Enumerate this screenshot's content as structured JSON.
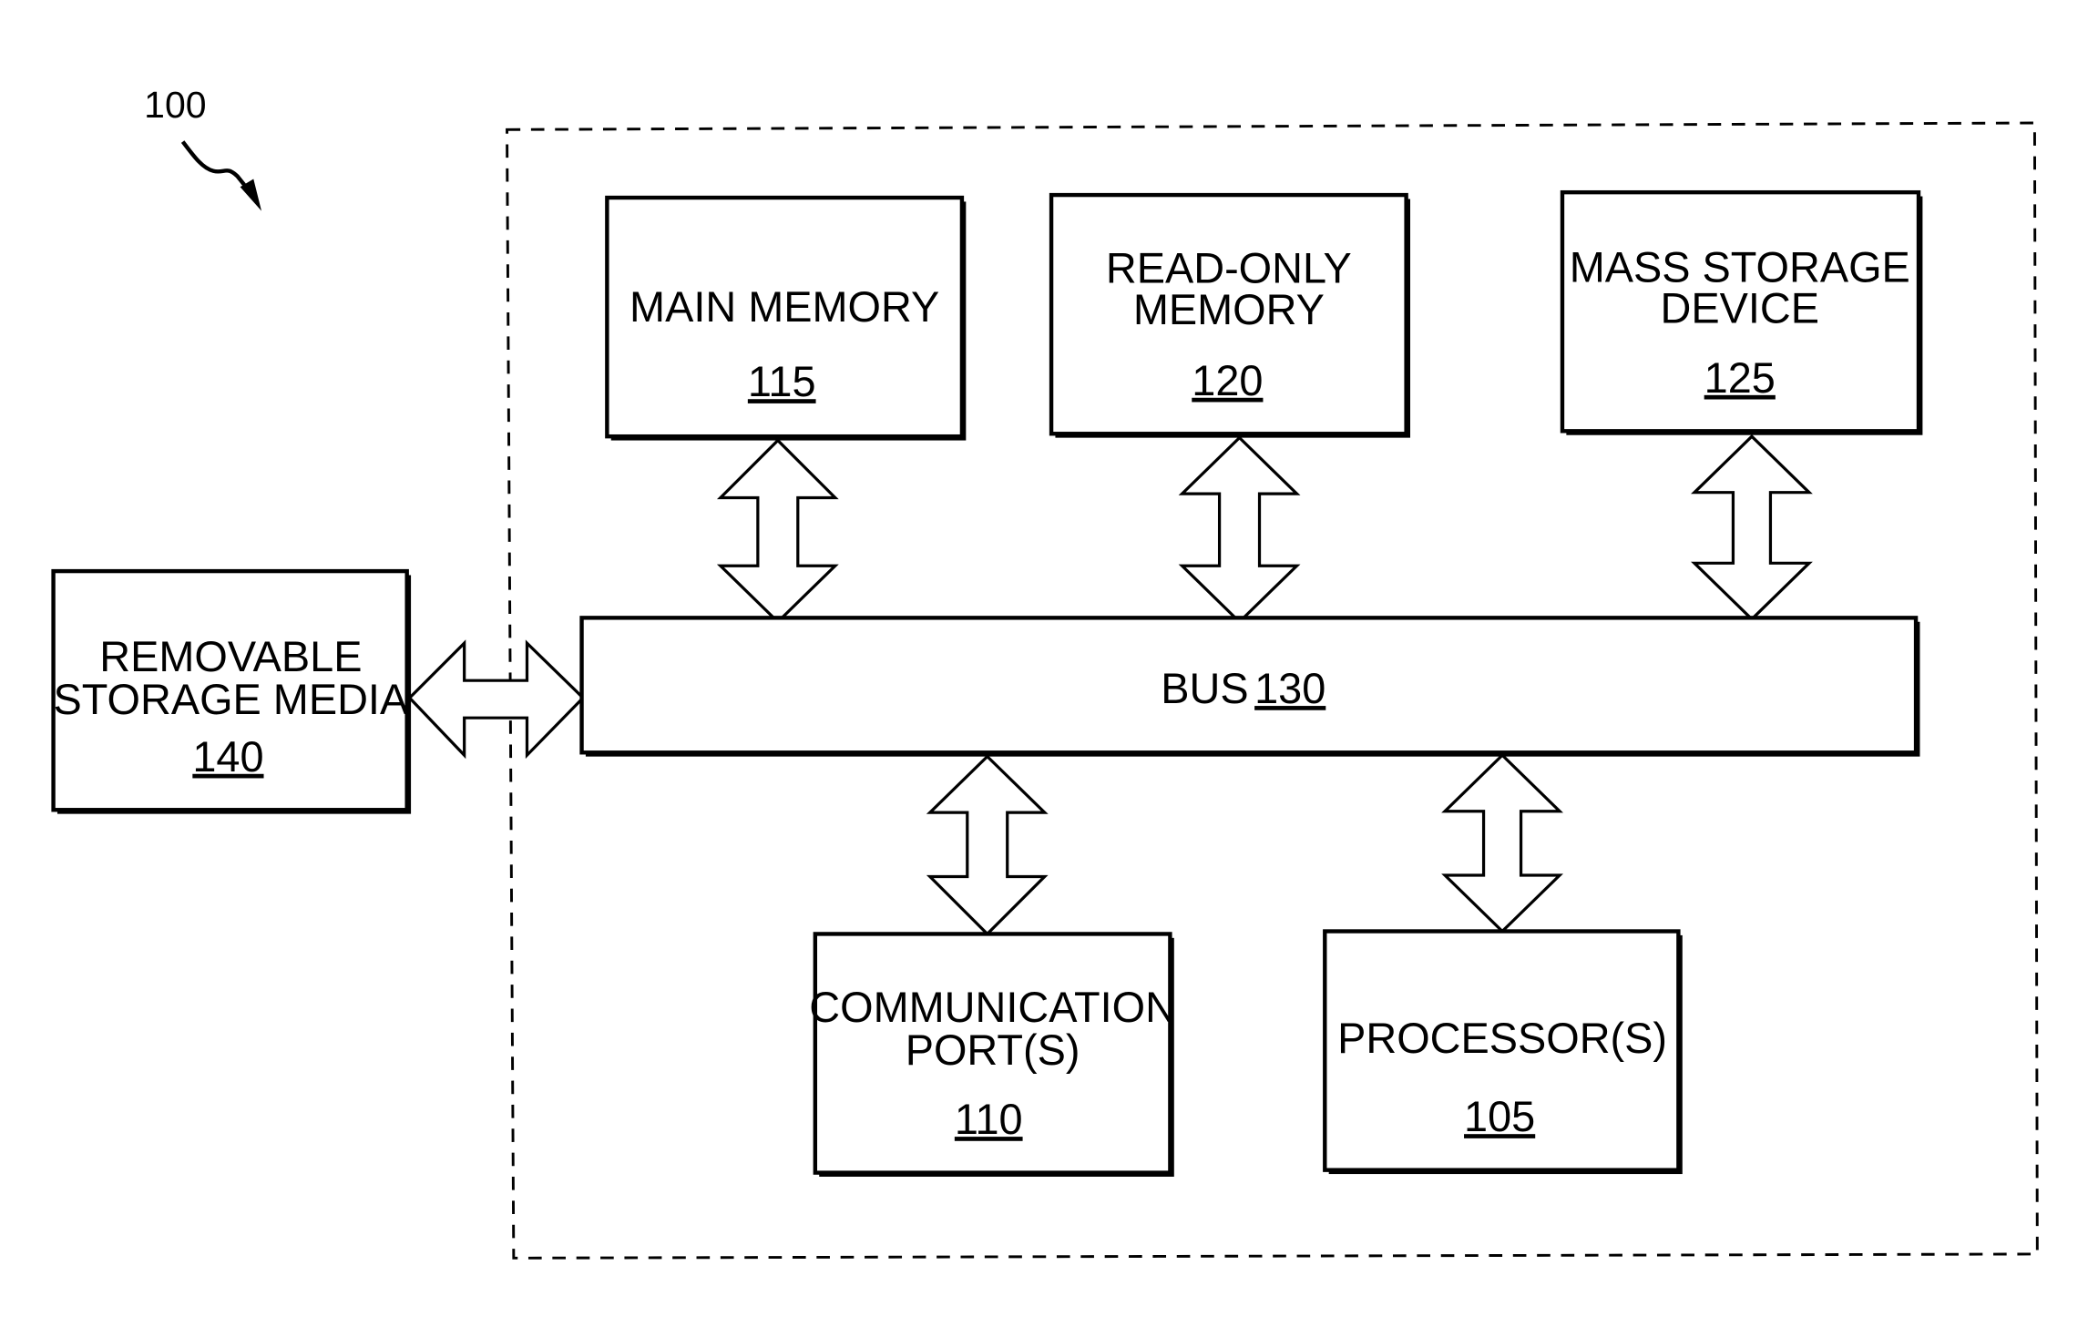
{
  "figure": {
    "reference": "100"
  },
  "system_boundary": {
    "style": "dashed"
  },
  "components": {
    "main_memory": {
      "label": [
        "MAIN MEMORY"
      ],
      "ref": "115"
    },
    "read_only_memory": {
      "label": [
        "READ-ONLY",
        "MEMORY"
      ],
      "ref": "120"
    },
    "mass_storage": {
      "label": [
        "MASS STORAGE",
        "DEVICE"
      ],
      "ref": "125"
    },
    "bus": {
      "label": "BUS",
      "ref": "130"
    },
    "removable_storage": {
      "label": [
        "REMOVABLE",
        "STORAGE MEDIA"
      ],
      "ref": "140"
    },
    "communication_port": {
      "label": [
        "COMMUNICATION",
        "PORT(S)"
      ],
      "ref": "110"
    },
    "processor": {
      "label": [
        "PROCESSOR(S)"
      ],
      "ref": "105"
    }
  },
  "connections": [
    {
      "from": "main_memory",
      "to": "bus",
      "type": "bidirectional"
    },
    {
      "from": "read_only_memory",
      "to": "bus",
      "type": "bidirectional"
    },
    {
      "from": "mass_storage",
      "to": "bus",
      "type": "bidirectional"
    },
    {
      "from": "removable_storage",
      "to": "bus",
      "type": "bidirectional"
    },
    {
      "from": "communication_port",
      "to": "bus",
      "type": "bidirectional"
    },
    {
      "from": "processor",
      "to": "bus",
      "type": "bidirectional"
    }
  ]
}
